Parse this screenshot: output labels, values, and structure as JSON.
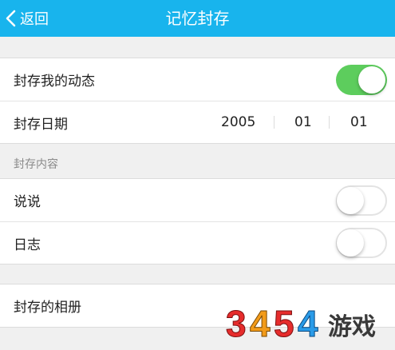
{
  "header": {
    "back_label": "返回",
    "title": "记忆封存",
    "background": "#18b4ed"
  },
  "settings": {
    "seal_dynamics": {
      "label": "封存我的动态",
      "enabled": true
    },
    "seal_date": {
      "label": "封存日期",
      "year": "2005",
      "month": "01",
      "day": "01"
    }
  },
  "content_section": {
    "title": "封存内容",
    "items": [
      {
        "label": "说说",
        "enabled": false
      },
      {
        "label": "日志",
        "enabled": false
      }
    ]
  },
  "album_row": {
    "label": "封存的相册"
  },
  "watermark": {
    "text": "3454游戏"
  },
  "colors": {
    "toggle_on": "#5dcd5d",
    "accent": "#18b4ed"
  }
}
